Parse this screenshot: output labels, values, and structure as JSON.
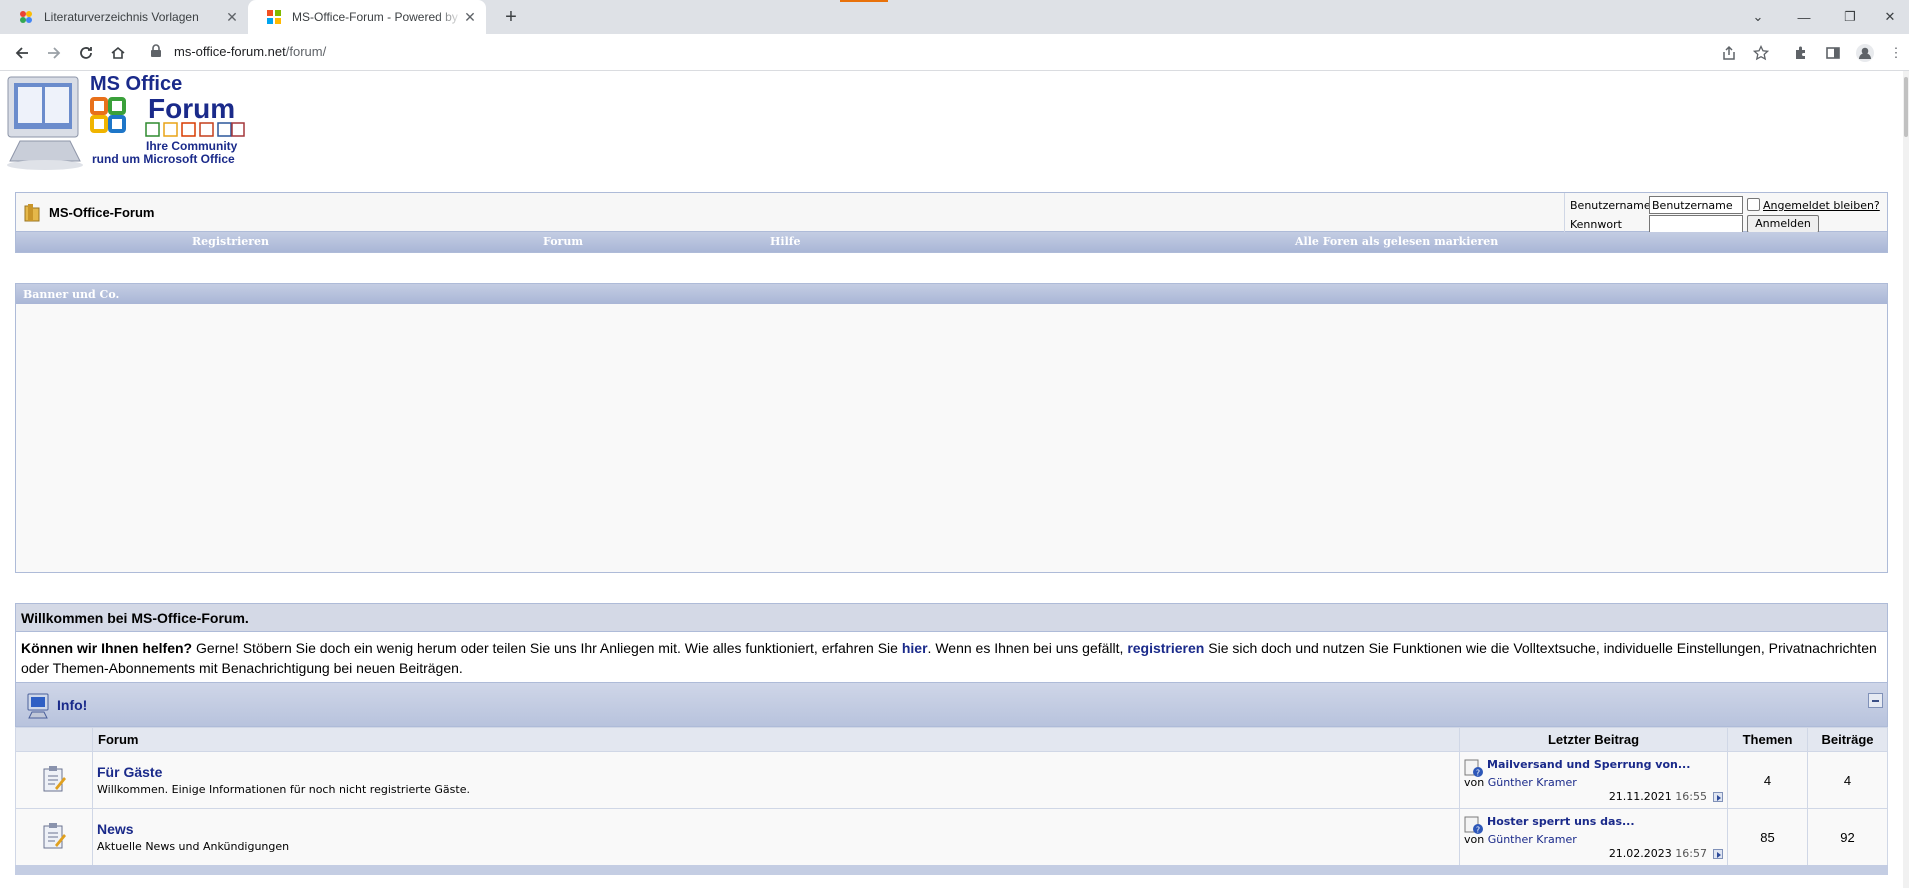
{
  "browser": {
    "tabs": [
      {
        "title": "Literaturverzeichnis Vorlagen",
        "active": false
      },
      {
        "title": "MS-Office-Forum - Powered by vBulletin",
        "active": true
      }
    ],
    "url_host": "ms-office-forum.net",
    "url_path": "/forum/"
  },
  "logo": {
    "line1": "MS Office",
    "line2": "Forum",
    "line3": "Ihre Community",
    "line4": "rund um Microsoft Office"
  },
  "navbar": {
    "breadcrumb": "MS-Office-Forum",
    "login": {
      "username_label": "Benutzername",
      "username_value": "Benutzername",
      "password_label": "Kennwort",
      "remember_label": "Angemeldet bleiben?",
      "submit_label": "Anmelden"
    },
    "menu": [
      "Registrieren",
      "Forum",
      "Hilfe",
      "Alle Foren als gelesen markieren"
    ]
  },
  "banner": {
    "title": "Banner und Co."
  },
  "welcome": {
    "title": "Willkommen bei MS-Office-Forum.",
    "lead": "Können wir Ihnen helfen?",
    "text1": " Gerne! Stöbern Sie doch ein wenig herum oder teilen Sie uns Ihr Anliegen mit. Wie alles funktioniert, erfahren Sie ",
    "link1": "hier",
    "text2": ". Wenn es Ihnen bei uns gefällt, ",
    "link2": "registrieren",
    "text3": " Sie sich doch und nutzen Sie Funktionen wie die Volltextsuche, individuelle Einstellungen, Privatnachrichten oder Themen-Abonnements mit Benachrichtigung bei neuen Beiträgen."
  },
  "category": {
    "name": "Info!"
  },
  "table": {
    "headers": {
      "forum": "Forum",
      "last": "Letzter Beitrag",
      "threads": "Themen",
      "posts": "Beiträge"
    },
    "rows": [
      {
        "title": "Für Gäste",
        "desc": "Willkommen. Einige Informationen für noch nicht registrierte Gäste.",
        "last_title": "Mailversand und Sperrung von...",
        "by_prefix": "von",
        "by_user": "Günther Kramer",
        "date": "21.11.2021",
        "time": "16:55",
        "threads": "4",
        "posts": "4"
      },
      {
        "title": "News",
        "desc": "Aktuelle News und Ankündigungen",
        "last_title": "Hoster sperrt uns das...",
        "by_prefix": "von",
        "by_user": "Günther Kramer",
        "date": "21.02.2023",
        "time": "16:57",
        "threads": "85",
        "posts": "92"
      }
    ]
  },
  "colors": {
    "accent": "#1a2a8a",
    "header_blue": "#aebbd8"
  }
}
